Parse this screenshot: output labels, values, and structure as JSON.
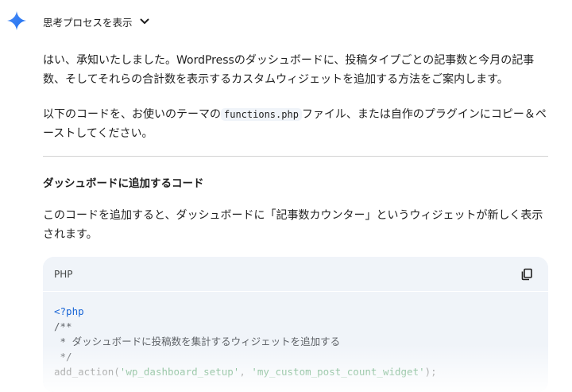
{
  "thoughts": {
    "toggle_label": "思考プロセスを表示",
    "icon": "chevron-down-icon"
  },
  "assistant_icon": "gemini-spark-icon",
  "response": {
    "paragraph1": "はい、承知いたしました。WordPressのダッシュボードに、投稿タイプごとの記事数と今月の記事数、そしてそれらの合計数を表示するカスタムウィジェットを追加する方法をご案内します。",
    "paragraph2_before": "以下のコードを、お使いのテーマの",
    "paragraph2_code": "functions.php",
    "paragraph2_after": "ファイル、または自作のプラグインにコピー＆ペーストしてください。",
    "heading": "ダッシュボードに追加するコード",
    "paragraph3": "このコードを追加すると、ダッシュボードに「記事数カウンター」というウィジェットが新しく表示されます。"
  },
  "code_block": {
    "language": "PHP",
    "copy_icon": "copy-icon",
    "lines": {
      "l1": "<?php",
      "l2": "/**",
      "l3": " * ダッシュボードに投稿数を集計するウィジェットを追加する",
      "l4": " */",
      "l5_fn": "add_action(",
      "l5_arg1": "'wp_dashboard_setup'",
      "l5_sep": ", ",
      "l5_arg2": "'my_custom_post_count_widget'",
      "l5_end": ");"
    }
  },
  "colors": {
    "accent_blue": "#1a66d6",
    "string_green": "#188038",
    "code_bg": "#f0f4f9"
  }
}
